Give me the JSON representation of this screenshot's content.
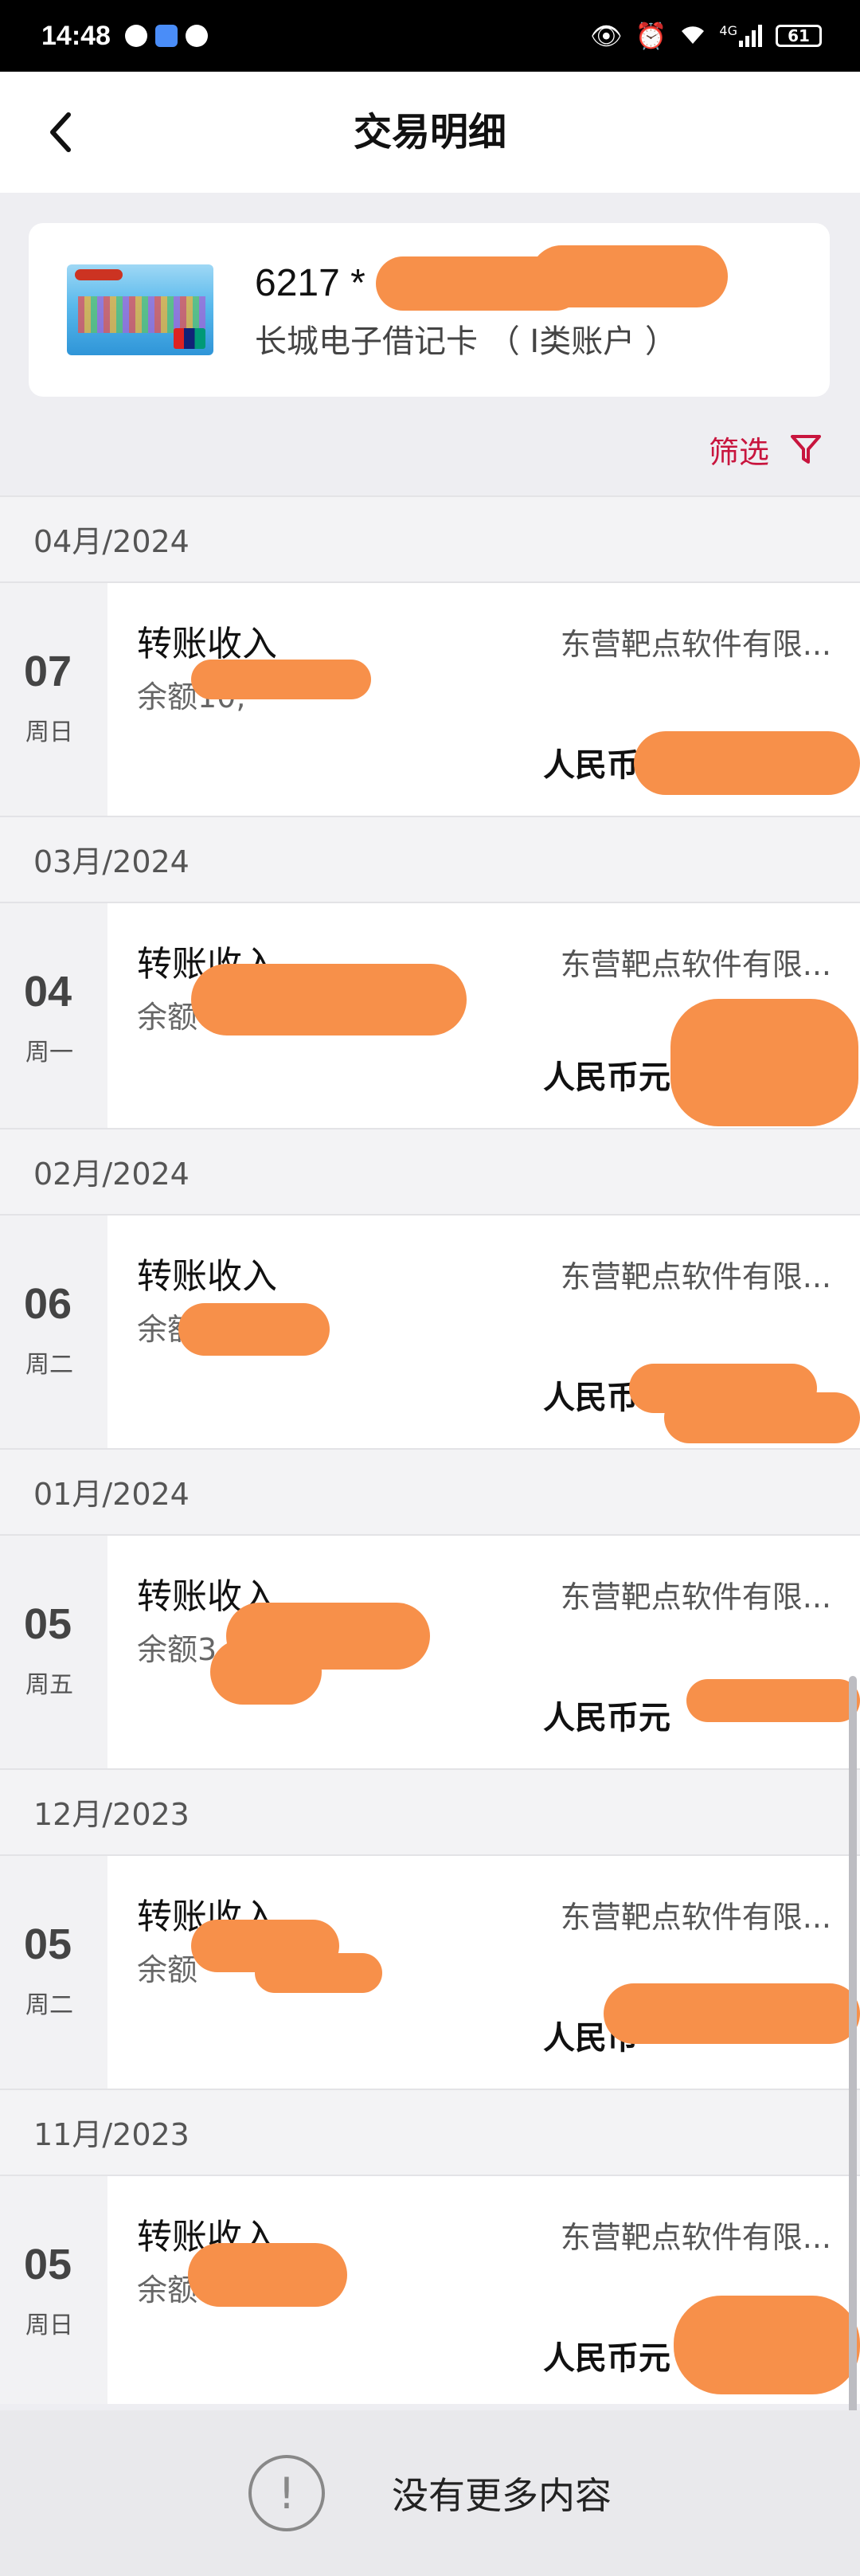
{
  "status_bar": {
    "time": "14:48",
    "network": "4G",
    "battery": "61",
    "icons": [
      "wechat-icon",
      "location-app-icon",
      "message-icon",
      "eye-icon",
      "alarm-icon",
      "wifi-icon",
      "signal-icon",
      "battery-icon"
    ]
  },
  "header": {
    "title": "交易明细",
    "back_icon": "chevron-left-icon"
  },
  "card": {
    "number": "6217 *",
    "type": "长城电子借记卡 （ I类账户 ）"
  },
  "filter": {
    "label": "筛选",
    "icon": "funnel-icon",
    "color": "#c8153e"
  },
  "months": [
    {
      "label": "04月/2024",
      "transactions": [
        {
          "day": "07",
          "weekday": "周日",
          "type": "转账收入",
          "balance": "余额10,",
          "counterparty": "东营靶点软件有限...",
          "currency": "人民币元",
          "amount": ""
        }
      ]
    },
    {
      "label": "03月/2024",
      "transactions": [
        {
          "day": "04",
          "weekday": "周一",
          "type": "转账收入",
          "balance": "余额",
          "counterparty": "东营靶点软件有限...",
          "currency": "人民币元",
          "amount": ""
        }
      ]
    },
    {
      "label": "02月/2024",
      "transactions": [
        {
          "day": "06",
          "weekday": "周二",
          "type": "转账收入",
          "balance": "余额",
          "counterparty": "东营靶点软件有限...",
          "currency": "人民币",
          "amount": ""
        }
      ]
    },
    {
      "label": "01月/2024",
      "transactions": [
        {
          "day": "05",
          "weekday": "周五",
          "type": "转账收入",
          "balance": "余额3",
          "counterparty": "东营靶点软件有限...",
          "currency": "人民币元",
          "amount": ""
        }
      ]
    },
    {
      "label": "12月/2023",
      "transactions": [
        {
          "day": "05",
          "weekday": "周二",
          "type": "转账收入",
          "balance": "余额",
          "counterparty": "东营靶点软件有限...",
          "currency": "人民币",
          "amount": ""
        }
      ]
    },
    {
      "label": "11月/2023",
      "transactions": [
        {
          "day": "05",
          "weekday": "周日",
          "type": "转账收入",
          "balance": "余额",
          "counterparty": "东营靶点软件有限...",
          "currency": "人民币元",
          "amount": ""
        }
      ]
    }
  ],
  "footer": {
    "text": "没有更多内容",
    "icon": "exclamation-circle-icon"
  },
  "colors": {
    "accent": "#c8153e",
    "redaction": "#f7904a",
    "background": "#eeeef2"
  }
}
